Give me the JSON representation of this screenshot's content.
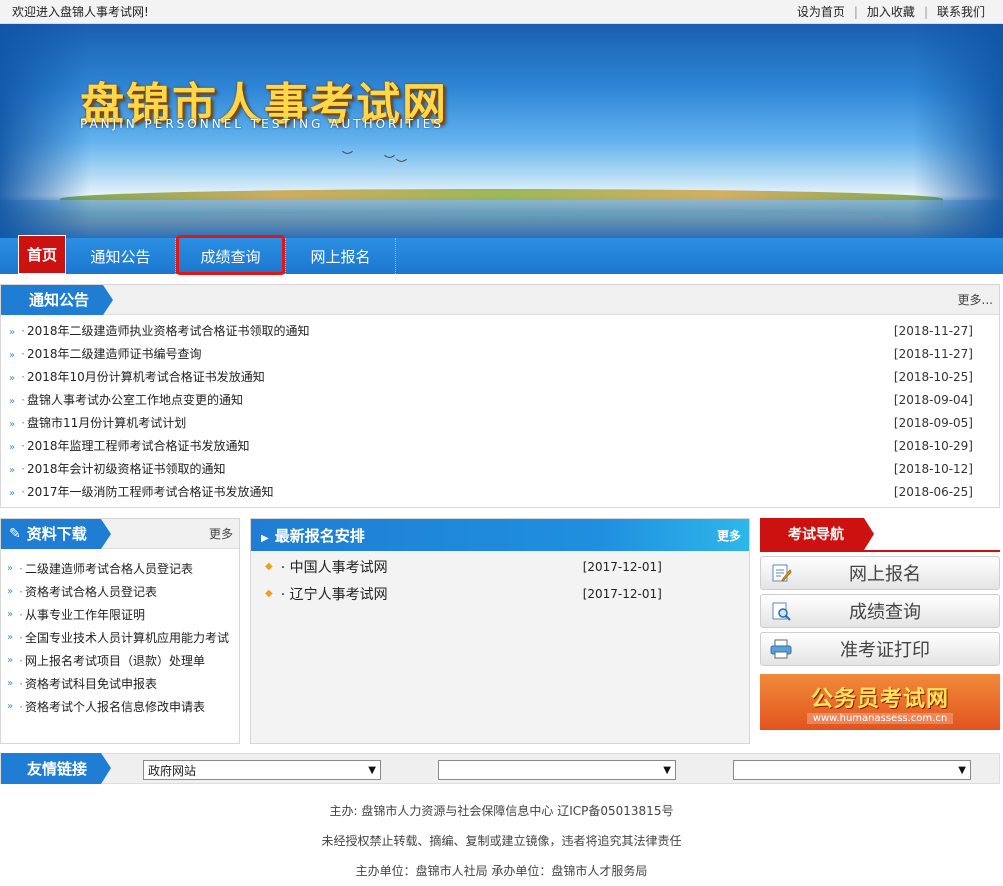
{
  "topbar": {
    "welcome": "欢迎进入盘锦人事考试网!",
    "links": [
      "设为首页",
      "加入收藏",
      "联系我们"
    ]
  },
  "banner": {
    "title": "盘锦市人事考试网",
    "subtitle": "PANJIN PERSONNEL TESTING AUTHORITIES"
  },
  "nav": {
    "items": [
      "首页",
      "通知公告",
      "成绩查询",
      "网上报名"
    ]
  },
  "notice": {
    "title": "通知公告",
    "more": "更多...",
    "items": [
      {
        "text": "2018年二级建造师执业资格考试合格证书领取的通知",
        "date": "[2018-11-27]"
      },
      {
        "text": "2018年二级建造师证书编号查询",
        "date": "[2018-11-27]"
      },
      {
        "text": "2018年10月份计算机考试合格证书发放通知",
        "date": "[2018-10-25]"
      },
      {
        "text": "盘锦人事考试办公室工作地点变更的通知",
        "date": "[2018-09-04]"
      },
      {
        "text": "盘锦市11月份计算机考试计划",
        "date": "[2018-09-05]"
      },
      {
        "text": "2018年监理工程师考试合格证书发放通知",
        "date": "[2018-10-29]"
      },
      {
        "text": "2018年会计初级资格证书领取的通知",
        "date": "[2018-10-12]"
      },
      {
        "text": "2017年一级消防工程师考试合格证书发放通知",
        "date": "[2018-06-25]"
      }
    ]
  },
  "downloads": {
    "title": "资料下载",
    "more": "更多",
    "items": [
      "二级建造师考试合格人员登记表",
      "资格考试合格人员登记表",
      "从事专业工作年限证明",
      "全国专业技术人员计算机应用能力考试",
      "网上报名考试项目（退款）处理单",
      "资格考试科目免试申报表",
      "资格考试个人报名信息修改申请表"
    ]
  },
  "latest": {
    "title": "最新报名安排",
    "more": "更多",
    "items": [
      {
        "text": "· 中国人事考试网",
        "date": "[2017-12-01]"
      },
      {
        "text": "· 辽宁人事考试网",
        "date": "[2017-12-01]"
      }
    ]
  },
  "guide": {
    "title": "考试导航",
    "buttons": [
      "网上报名",
      "成绩查询",
      "准考证打印"
    ],
    "ad_title": "公务员考试网",
    "ad_url": "www.humanassess.com.cn"
  },
  "friend_links": {
    "title": "友情链接",
    "selects": [
      "政府网站",
      "",
      ""
    ]
  },
  "footer": {
    "line1": "主办:  盘锦市人力资源与社会保障信息中心 辽ICP备05013815号",
    "line2": "未经授权禁止转载、摘编、复制或建立镜像，违者将追究其法律责任",
    "line3": "主办单位：盘锦市人社局 承办单位：盘锦市人才服务局"
  },
  "colors": {
    "primary_blue": "#1f7ed3",
    "accent_red": "#cc1111",
    "highlight_border": "#e51515"
  }
}
